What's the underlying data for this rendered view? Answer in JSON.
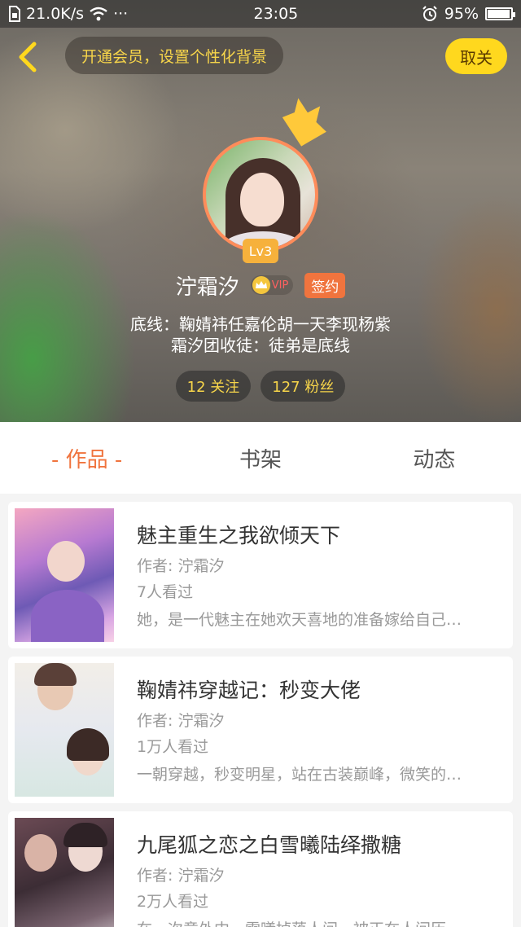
{
  "status_bar": {
    "network_speed": "21.0K/s",
    "more": "···",
    "time": "23:05",
    "battery": "95%",
    "battery_level": 0.95
  },
  "header": {
    "vip_banner": "开通会员，设置个性化背景",
    "unfollow_label": "取关"
  },
  "profile": {
    "level": "Lv3",
    "name": "泞霜汐",
    "vip_label": "VIP",
    "signed_label": "签约",
    "bio_line1": "底线：鞠婧祎任嘉伦胡一天李现杨紫",
    "bio_line2": "霜汐团收徒：徒弟是底线",
    "following": "12 关注",
    "followers": "127 粉丝"
  },
  "tabs": [
    {
      "label": "- 作品 -",
      "active": true
    },
    {
      "label": "书架",
      "active": false
    },
    {
      "label": "动态",
      "active": false
    }
  ],
  "books": [
    {
      "title": "魅主重生之我欲倾天下",
      "author": "作者: 泞霜汐",
      "views": "7人看过",
      "description": "她，是一代魅主在她欢天喜地的准备嫁给自己…"
    },
    {
      "title": "鞠婧祎穿越记：秒变大佬",
      "author": "作者: 泞霜汐",
      "views": "1万人看过",
      "description": "一朝穿越，秒变明星，站在古装巅峰，微笑的…"
    },
    {
      "title": "九尾狐之恋之白雪曦陆绎撒糖",
      "author": "作者: 泞霜汐",
      "views": "2万人看过",
      "description": "在一次意外中，雪曦掉落人间，被正在人间历…"
    }
  ],
  "colors": {
    "accent_orange": "#f0743e",
    "vip_yellow": "#f7d54a",
    "button_yellow": "#ffd81e",
    "level_badge": "#f6b13c"
  },
  "icons": [
    "back-arrow-icon",
    "crown-icon",
    "wifi-icon",
    "clock-icon",
    "battery-icon",
    "vip-crown-icon"
  ]
}
